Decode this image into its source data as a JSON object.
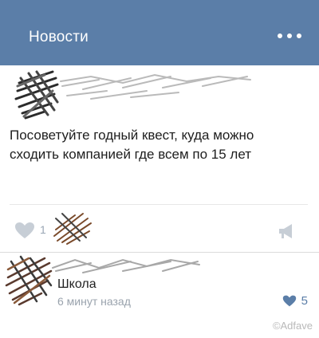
{
  "header": {
    "title": "Новости",
    "more_icon": "more-dots-icon",
    "background": "#5b7ea8"
  },
  "post": {
    "text": "Посоветуйте годный квест, куда можно\nсходить компанией где всем по 15 лет",
    "likes_count": "1",
    "like_icon": "heart-icon",
    "share_icon": "megaphone-icon"
  },
  "comment": {
    "text": "Школа",
    "time": "6 минут назад",
    "likes_count": "5",
    "like_icon": "heart-icon",
    "like_color": "#5b7ea8"
  },
  "watermark": "©Adfave"
}
